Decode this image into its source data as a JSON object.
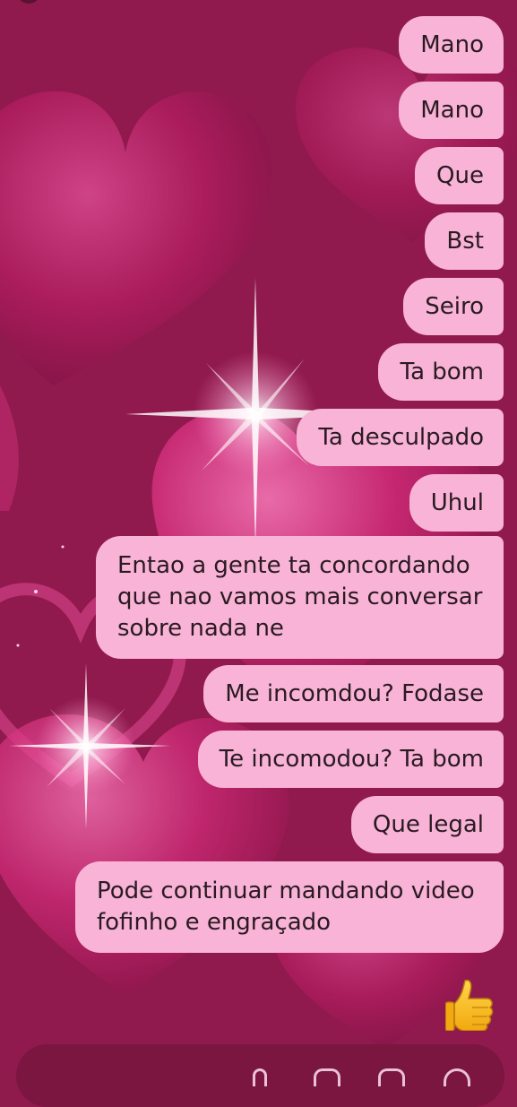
{
  "messages": [
    {
      "text": "Mano"
    },
    {
      "text": "Mano"
    },
    {
      "text": "Que"
    },
    {
      "text": "Bst"
    },
    {
      "text": "Seiro"
    },
    {
      "text": "Ta bom"
    },
    {
      "text": "Ta desculpado"
    },
    {
      "text": "Uhul"
    },
    {
      "text": "Entao a gente ta concordando\nque nao vamos mais conversar\nsobre nada ne"
    },
    {
      "text": "Me incomdou? Fodase"
    },
    {
      "text": "Te incomodou? Ta bom"
    },
    {
      "text": "Que legal"
    },
    {
      "text": "Pode continuar mandando video\nfofinho e engraçado"
    }
  ],
  "reaction_icon": "thumbs-up-icon",
  "colors": {
    "bubble": "#f8b3d6",
    "background": "#8f1a4c",
    "text": "#2a1a22"
  }
}
